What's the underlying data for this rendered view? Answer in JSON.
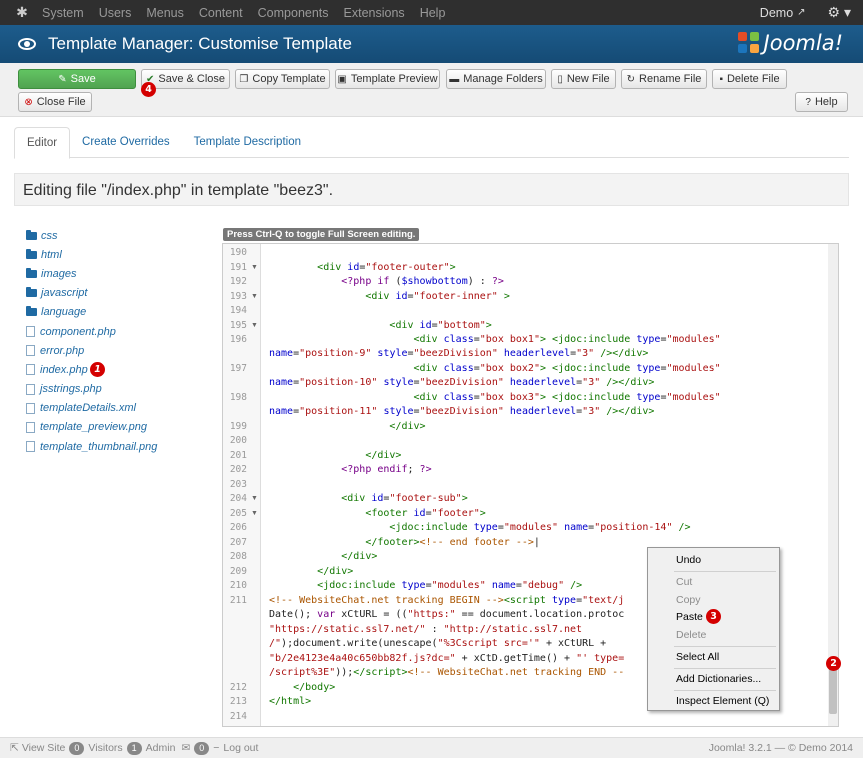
{
  "navbar": {
    "items": [
      "System",
      "Users",
      "Menus",
      "Content",
      "Components",
      "Extensions",
      "Help"
    ],
    "user": "Demo"
  },
  "header": {
    "title": "Template Manager: Customise Template",
    "brand": "Joomla!"
  },
  "toolbar": {
    "save": "Save",
    "save_close": "Save & Close",
    "copy_template": "Copy Template",
    "template_preview": "Template Preview",
    "manage_folders": "Manage Folders",
    "new_file": "New File",
    "rename_file": "Rename File",
    "delete_file": "Delete File",
    "close_file": "Close File",
    "help": "Help"
  },
  "tabs": [
    "Editor",
    "Create Overrides",
    "Template Description"
  ],
  "banner": "Editing file \"/index.php\" in template \"beez3\".",
  "tree": {
    "folders": [
      "css",
      "html",
      "images",
      "javascript",
      "language"
    ],
    "files": [
      "component.php",
      "error.php",
      "index.php",
      "jsstrings.php",
      "templateDetails.xml",
      "template_preview.png",
      "template_thumbnail.png"
    ]
  },
  "editor": {
    "hint": "Press Ctrl-Q to toggle Full Screen editing."
  },
  "context_menu": {
    "undo": "Undo",
    "cut": "Cut",
    "copy": "Copy",
    "paste": "Paste",
    "delete": "Delete",
    "select_all": "Select All",
    "add_dictionaries": "Add Dictionaries...",
    "inspect": "Inspect Element (Q)"
  },
  "badges": {
    "b1": "1",
    "b2": "2",
    "b3": "3",
    "b4": "4"
  },
  "status": {
    "view_site": "View Site",
    "visitors_count": "0",
    "visitors": "Visitors",
    "admin_count": "1",
    "admin": "Admin",
    "mail_count": "0",
    "logout": "Log out",
    "version": "Joomla! 3.2.1 — © Demo 2014"
  }
}
